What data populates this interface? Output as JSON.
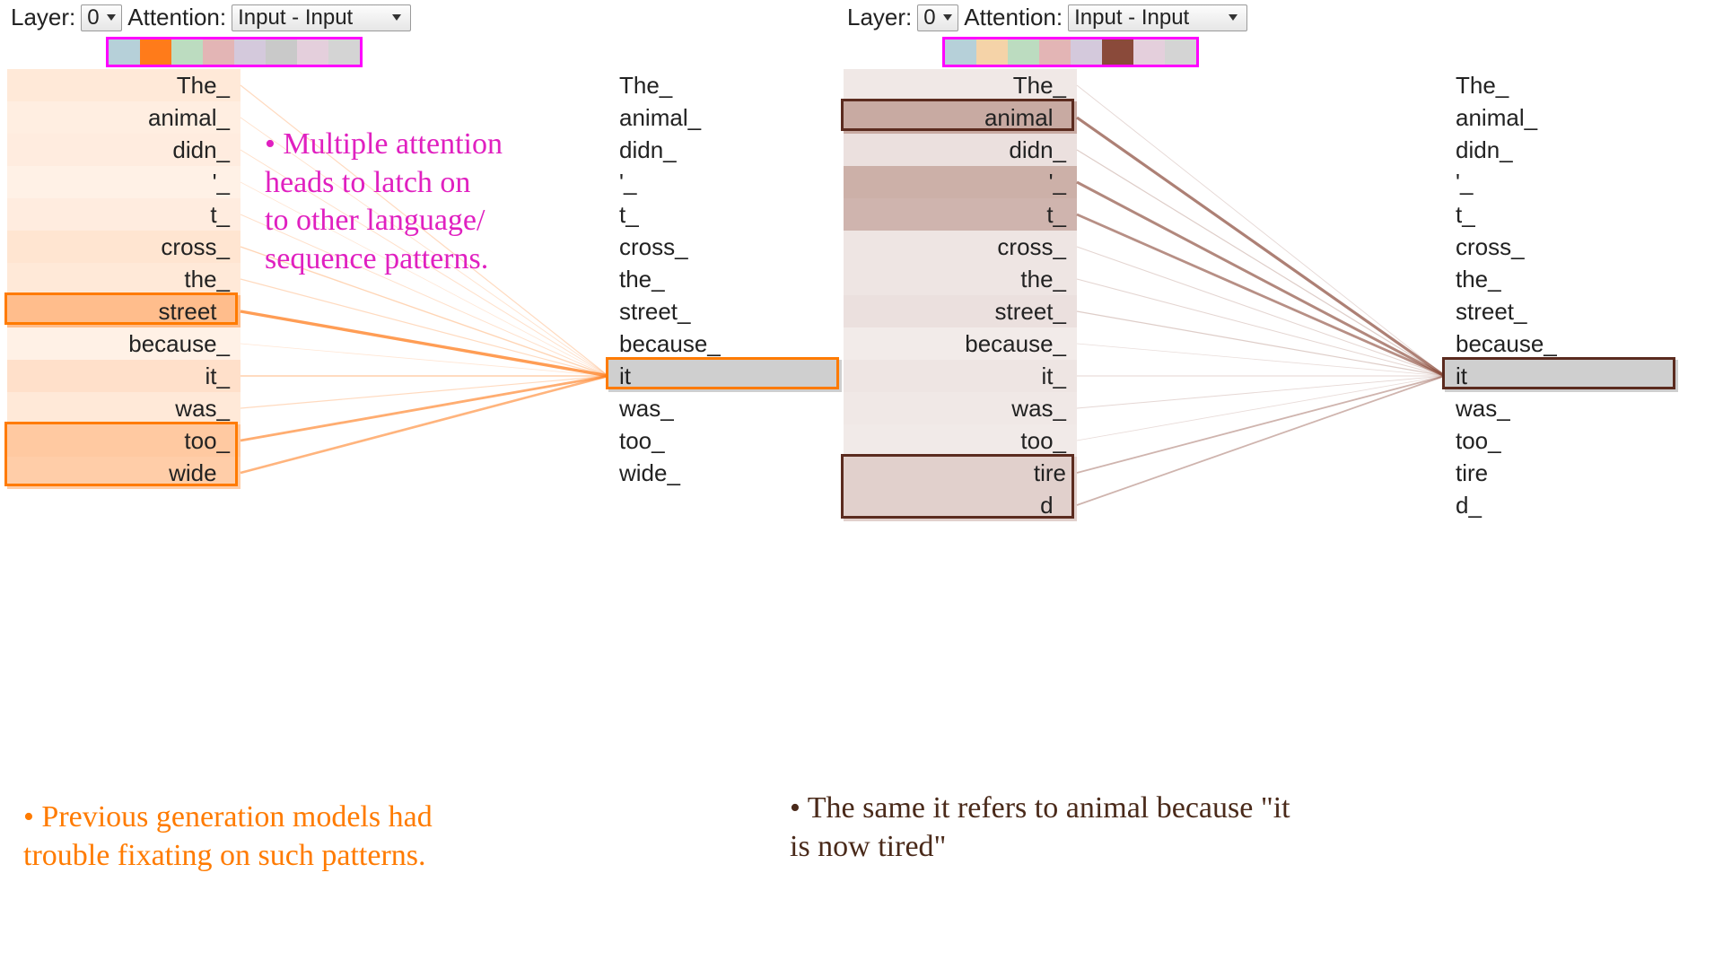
{
  "labels": {
    "layer": "Layer:",
    "attention": "Attention:"
  },
  "selects": {
    "layer_value": "0",
    "attention_value": "Input - Input"
  },
  "heads_left": [
    "#b6d0d9",
    "#ff7b1a",
    "#bcdcc0",
    "#e3b5b5",
    "#d4c9dc",
    "#c9c9c9",
    "#e4cfdc",
    "#d4d4d4"
  ],
  "heads_right": [
    "#b6d0d9",
    "#f5d3a8",
    "#bcdcc0",
    "#e3b5b5",
    "#d4c9dc",
    "#8a4a3a",
    "#e4cfdc",
    "#d4d4d4"
  ],
  "tokens_left_panel": [
    "The_",
    "animal_",
    "didn_",
    "'_",
    "t_",
    "cross_",
    "the_",
    "street_",
    "because_",
    "it_",
    "was_",
    "too_",
    "wide_"
  ],
  "tokens_right_panel": [
    "The_",
    "animal_",
    "didn_",
    "'_",
    "t_",
    "cross_",
    "the_",
    "street_",
    "because_",
    "it_",
    "was_",
    "too_",
    "tire",
    "d_"
  ],
  "attn_left": {
    "target_idx": 9,
    "color": "#ff7b1a",
    "weights": [
      0.15,
      0.08,
      0.1,
      0.05,
      0.1,
      0.2,
      0.15,
      0.7,
      0.05,
      0.25,
      0.15,
      0.55,
      0.5
    ],
    "hl_left_idx": [
      [
        7
      ],
      [
        11,
        12
      ]
    ],
    "hl_right_idx": [
      9
    ]
  },
  "attn_right": {
    "target_idx": 9,
    "color": "#8a4a3a",
    "weights": [
      0.08,
      0.65,
      0.15,
      0.6,
      0.55,
      0.1,
      0.1,
      0.15,
      0.05,
      0.1,
      0.08,
      0.06,
      0.3,
      0.3
    ],
    "hl_left_idx": [
      [
        1
      ],
      [
        12,
        13
      ]
    ],
    "hl_right_idx": [
      9
    ]
  },
  "annotations": {
    "magenta": "• Multiple attention\nheads to latch on\nto other language/\nsequence patterns.",
    "orange": "• Previous generation models had\ntrouble fixating on such patterns.",
    "brown": "• The same it refers to animal because \"it\nis now tired\""
  }
}
